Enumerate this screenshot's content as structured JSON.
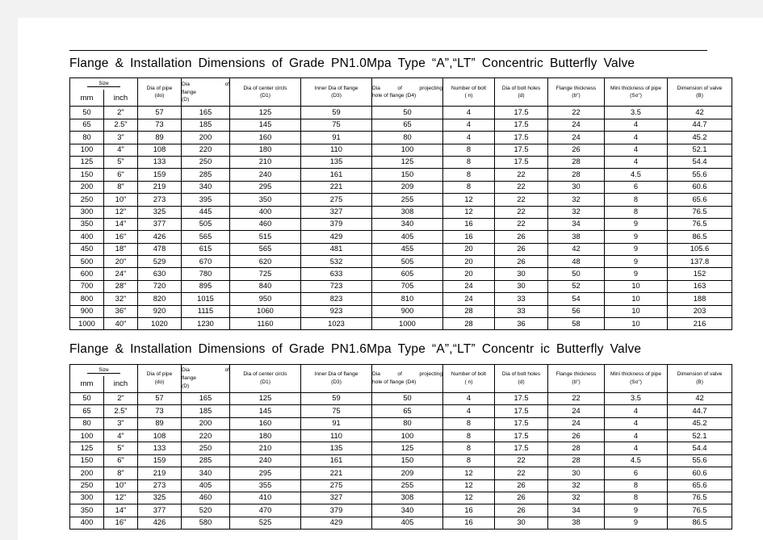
{
  "document": {
    "tail_mark": "."
  },
  "tables": [
    {
      "title": "Flange & Installation Dimensions of Grade PN1.0Mpa Type “A”,“LT” Concentric Butterfly Valve",
      "header": {
        "size_group": "Size",
        "size_mm": "mm",
        "size_inch": "inch",
        "col_do_l1": "Dia of pipe",
        "col_do_l2": "(do)",
        "col_D_l1": "Dia",
        "col_D_l1b": "of",
        "col_D_l2": "flange",
        "col_D_l3": "(D)",
        "col_D1_l1": "Dia of center circls",
        "col_D1_l2": "(D1)",
        "col_D3_l1": "Inner Dia of flange",
        "col_D3_l2": "(D3)",
        "col_D4_l1": "Dia",
        "col_D4_l1b": "of",
        "col_D4_l1c": "projecting",
        "col_D4_l2": "hole of flange (D4)",
        "col_n_l1": "Number of bolt",
        "col_n_l2": "( n)",
        "col_d_l1": "Dia of bolt holes",
        "col_d_l2": "(d)",
        "col_b_l1": "Flange thickness",
        "col_b_l2": "(b\")",
        "col_So_l1": "Mini thickness of pipe",
        "col_So_l2": "(So\")",
        "col_B_l1": "Dimension of valve",
        "col_B_l2": "(B)"
      },
      "rows": [
        [
          "50",
          "2\"",
          "57",
          "165",
          "125",
          "59",
          "50",
          "4",
          "17.5",
          "22",
          "3.5",
          "42"
        ],
        [
          "65",
          "2.5\"",
          "73",
          "185",
          "145",
          "75",
          "65",
          "4",
          "17.5",
          "24",
          "4",
          "44.7"
        ],
        [
          "80",
          "3\"",
          "89",
          "200",
          "160",
          "91",
          "80",
          "4",
          "17.5",
          "24",
          "4",
          "45.2"
        ],
        [
          "100",
          "4\"",
          "108",
          "220",
          "180",
          "110",
          "100",
          "8",
          "17.5",
          "26",
          "4",
          "52.1"
        ],
        [
          "125",
          "5\"",
          "133",
          "250",
          "210",
          "135",
          "125",
          "8",
          "17.5",
          "28",
          "4",
          "54.4"
        ],
        [
          "150",
          "6\"",
          "159",
          "285",
          "240",
          "161",
          "150",
          "8",
          "22",
          "28",
          "4.5",
          "55.6"
        ],
        [
          "200",
          "8\"",
          "219",
          "340",
          "295",
          "221",
          "209",
          "8",
          "22",
          "30",
          "6",
          "60.6"
        ],
        [
          "250",
          "10\"",
          "273",
          "395",
          "350",
          "275",
          "255",
          "12",
          "22",
          "32",
          "8",
          "65.6"
        ],
        [
          "300",
          "12\"",
          "325",
          "445",
          "400",
          "327",
          "308",
          "12",
          "22",
          "32",
          "8",
          "76.5"
        ],
        [
          "350",
          "14\"",
          "377",
          "505",
          "460",
          "379",
          "340",
          "16",
          "22",
          "34",
          "9",
          "76.5"
        ],
        [
          "400",
          "16\"",
          "426",
          "565",
          "515",
          "429",
          "405",
          "16",
          "26",
          "38",
          "9",
          "86.5"
        ],
        [
          "450",
          "18\"",
          "478",
          "615",
          "565",
          "481",
          "455",
          "20",
          "26",
          "42",
          "9",
          "105.6"
        ],
        [
          "500",
          "20\"",
          "529",
          "670",
          "620",
          "532",
          "505",
          "20",
          "26",
          "48",
          "9",
          "137.8"
        ],
        [
          "600",
          "24\"",
          "630",
          "780",
          "725",
          "633",
          "605",
          "20",
          "30",
          "50",
          "9",
          "152"
        ],
        [
          "700",
          "28\"",
          "720",
          "895",
          "840",
          "723",
          "705",
          "24",
          "30",
          "52",
          "10",
          "163"
        ],
        [
          "800",
          "32\"",
          "820",
          "1015",
          "950",
          "823",
          "810",
          "24",
          "33",
          "54",
          "10",
          "188"
        ],
        [
          "900",
          "36\"",
          "920",
          "1115",
          "1060",
          "923",
          "900",
          "28",
          "33",
          "56",
          "10",
          "203"
        ],
        [
          "1000",
          "40\"",
          "1020",
          "1230",
          "1160",
          "1023",
          "1000",
          "28",
          "36",
          "58",
          "10",
          "216"
        ]
      ]
    },
    {
      "title": "Flange & Installation Dimensions of Grade PN1.6Mpa Type “A”,“LT” Concentr ic Butterfly Valve",
      "header": {
        "size_group": "Size",
        "size_mm": "mm",
        "size_inch": "inch",
        "col_do_l1": "Dia of pipe",
        "col_do_l2": "(do)",
        "col_D_l1": "Dia",
        "col_D_l1b": "of",
        "col_D_l2": "flange",
        "col_D_l3": "(D)",
        "col_D1_l1": "Dia of center circls",
        "col_D1_l2": "(D1)",
        "col_D3_l1": "Inner Dia of flange",
        "col_D3_l2": "(D3)",
        "col_D4_l1": "Dia",
        "col_D4_l1b": "of",
        "col_D4_l1c": "projecting",
        "col_D4_l2": "hole of flange (D4)",
        "col_n_l1": "Number of bolt",
        "col_n_l2": "( n)",
        "col_d_l1": "Dia of bolt holes",
        "col_d_l2": "(d)",
        "col_b_l1": "Flange thickness",
        "col_b_l2": "(b\")",
        "col_So_l1": "Mini thickness of pipe",
        "col_So_l2": "(So\")",
        "col_B_l1": "Dimension of valve",
        "col_B_l2": "(B)"
      },
      "rows": [
        [
          "50",
          "2\"",
          "57",
          "165",
          "125",
          "59",
          "50",
          "4",
          "17.5",
          "22",
          "3.5",
          "42"
        ],
        [
          "65",
          "2.5\"",
          "73",
          "185",
          "145",
          "75",
          "65",
          "4",
          "17.5",
          "24",
          "4",
          "44.7"
        ],
        [
          "80",
          "3\"",
          "89",
          "200",
          "160",
          "91",
          "80",
          "8",
          "17.5",
          "24",
          "4",
          "45.2"
        ],
        [
          "100",
          "4\"",
          "108",
          "220",
          "180",
          "110",
          "100",
          "8",
          "17.5",
          "26",
          "4",
          "52.1"
        ],
        [
          "125",
          "5\"",
          "133",
          "250",
          "210",
          "135",
          "125",
          "8",
          "17.5",
          "28",
          "4",
          "54.4"
        ],
        [
          "150",
          "6\"",
          "159",
          "285",
          "240",
          "161",
          "150",
          "8",
          "22",
          "28",
          "4.5",
          "55.6"
        ],
        [
          "200",
          "8\"",
          "219",
          "340",
          "295",
          "221",
          "209",
          "12",
          "22",
          "30",
          "6",
          "60.6"
        ],
        [
          "250",
          "10\"",
          "273",
          "405",
          "355",
          "275",
          "255",
          "12",
          "26",
          "32",
          "8",
          "65.6"
        ],
        [
          "300",
          "12\"",
          "325",
          "460",
          "410",
          "327",
          "308",
          "12",
          "26",
          "32",
          "8",
          "76.5"
        ],
        [
          "350",
          "14\"",
          "377",
          "520",
          "470",
          "379",
          "340",
          "16",
          "26",
          "34",
          "9",
          "76.5"
        ],
        [
          "400",
          "16\"",
          "426",
          "580",
          "525",
          "429",
          "405",
          "16",
          "30",
          "38",
          "9",
          "86.5"
        ]
      ]
    }
  ]
}
